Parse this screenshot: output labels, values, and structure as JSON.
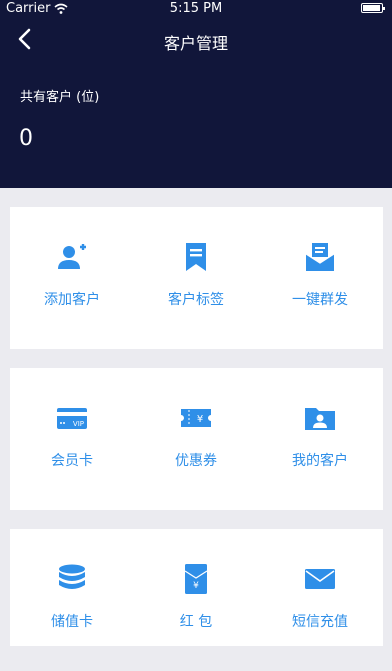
{
  "status_bar": {
    "carrier": "Carrier",
    "time": "5:15 PM"
  },
  "nav": {
    "title": "客户管理"
  },
  "summary": {
    "label": "共有客户 (位)",
    "value": "0"
  },
  "accent_color": "#2f8fe8",
  "grid": [
    [
      {
        "label": "添加客户",
        "icon": "add-user-icon"
      },
      {
        "label": "客户标签",
        "icon": "bookmark-tag-icon"
      },
      {
        "label": "一键群发",
        "icon": "mail-broadcast-icon"
      }
    ],
    [
      {
        "label": "会员卡",
        "icon": "vip-card-icon"
      },
      {
        "label": "优惠券",
        "icon": "coupon-icon"
      },
      {
        "label": "我的客户",
        "icon": "customer-folder-icon"
      }
    ],
    [
      {
        "label": "储值卡",
        "icon": "stored-value-icon"
      },
      {
        "label": "红 包",
        "icon": "red-envelope-icon"
      },
      {
        "label": "短信充值",
        "icon": "sms-icon"
      }
    ]
  ]
}
